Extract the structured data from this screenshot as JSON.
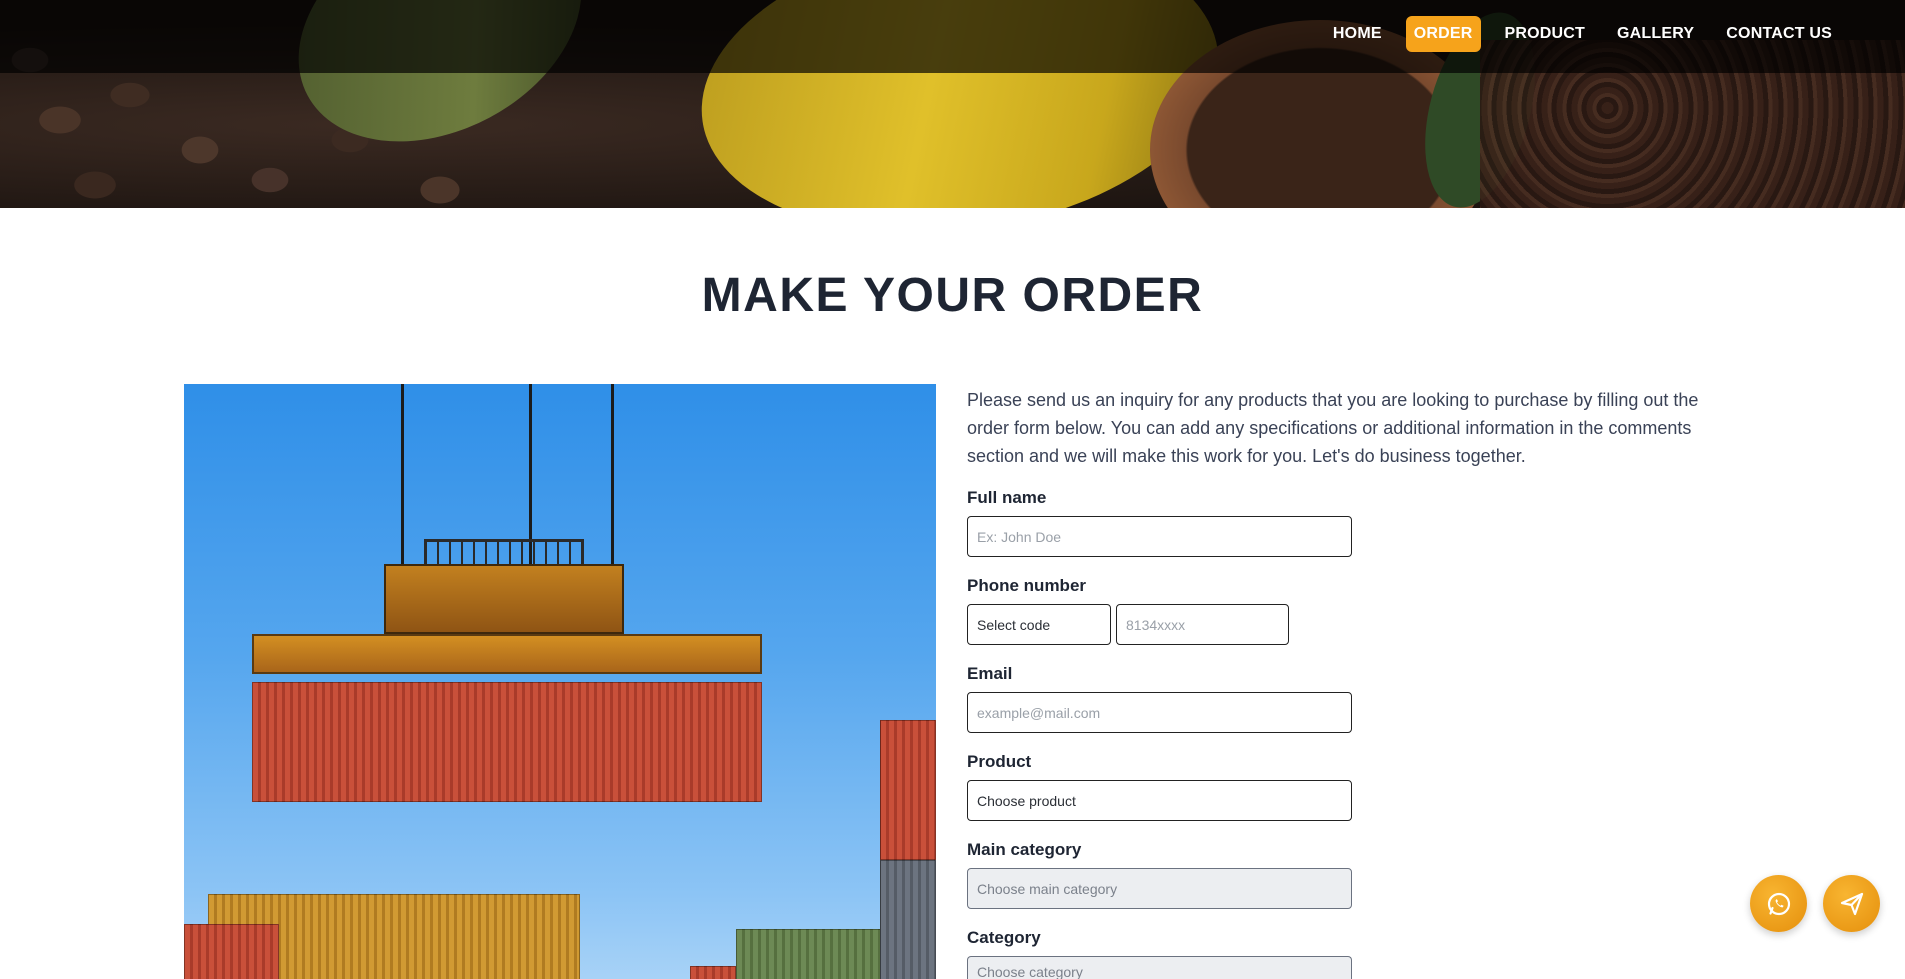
{
  "nav": {
    "items": [
      {
        "label": "HOME",
        "active": false
      },
      {
        "label": "ORDER",
        "active": true
      },
      {
        "label": "PRODUCT",
        "active": false
      },
      {
        "label": "GALLERY",
        "active": false
      },
      {
        "label": "CONTACT US",
        "active": false
      }
    ],
    "accent": "#f6a31b"
  },
  "page": {
    "title": "MAKE YOUR ORDER",
    "intro": "Please send us an inquiry for any products that you are looking to purchase by filling out the order form below. You can add any specifications or additional information in the comments section and we will make this work for you. Let's do business together."
  },
  "form": {
    "full_name": {
      "label": "Full name",
      "placeholder": "Ex: John Doe"
    },
    "phone": {
      "label": "Phone number",
      "code_value": "Select code",
      "number_placeholder": "8134xxxx"
    },
    "email": {
      "label": "Email",
      "placeholder": "example@mail.com"
    },
    "product": {
      "label": "Product",
      "value": "Choose product"
    },
    "main_category": {
      "label": "Main category",
      "value": "Choose main category"
    },
    "category": {
      "label": "Category",
      "value": "Choose category"
    }
  },
  "floating": {
    "whatsapp_icon": "whatsapp-icon",
    "send_icon": "paper-plane-icon"
  }
}
